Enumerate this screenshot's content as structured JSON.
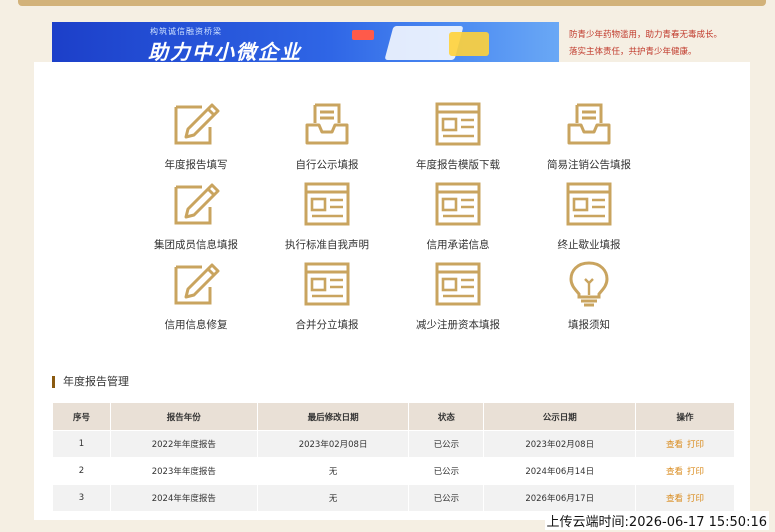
{
  "banner": {
    "small_text": "构筑诚信融资桥梁",
    "big_text": "助力中小微企业"
  },
  "notice": {
    "line1": "防青少年药物滥用，助力青春无毒成长。",
    "line2": "落实主体责任，共护青少年健康。"
  },
  "menu": [
    {
      "label": "年度报告填写",
      "icon": "pencil-doc-icon"
    },
    {
      "label": "自行公示填报",
      "icon": "inbox-doc-icon"
    },
    {
      "label": "年度报告模版下载",
      "icon": "form-doc-icon"
    },
    {
      "label": "简易注销公告填报",
      "icon": "inbox-doc-icon"
    },
    {
      "label": "集团成员信息填报",
      "icon": "pencil-doc-icon"
    },
    {
      "label": "执行标准自我声明",
      "icon": "form-doc-icon"
    },
    {
      "label": "信用承诺信息",
      "icon": "form-doc-icon"
    },
    {
      "label": "终止歇业填报",
      "icon": "form-doc-icon"
    },
    {
      "label": "信用信息修复",
      "icon": "pencil-doc-icon"
    },
    {
      "label": "合并分立填报",
      "icon": "form-doc-icon"
    },
    {
      "label": "减少注册资本填报",
      "icon": "form-doc-icon"
    },
    {
      "label": "填报须知",
      "icon": "lightbulb-icon"
    }
  ],
  "section_title": "年度报告管理",
  "table": {
    "headers": [
      "序号",
      "报告年份",
      "最后修改日期",
      "状态",
      "公示日期",
      "操作"
    ],
    "rows": [
      {
        "no": "1",
        "year": "2022年年度报告",
        "modified": "2023年02月08日",
        "status": "已公示",
        "publish": "2023年02月08日",
        "view": "查看",
        "print": "打印"
      },
      {
        "no": "2",
        "year": "2023年年度报告",
        "modified": "无",
        "status": "已公示",
        "publish": "2024年06月14日",
        "view": "查看",
        "print": "打印"
      },
      {
        "no": "3",
        "year": "2024年年度报告",
        "modified": "无",
        "status": "已公示",
        "publish": "2026年06月17日",
        "view": "查看",
        "print": "打印"
      }
    ]
  },
  "timestamp": "上传云端时间:2026-06-17 15:50:16",
  "colors": {
    "accent": "#c9a45f",
    "link": "#d98a1b",
    "notice": "#c0392b"
  }
}
